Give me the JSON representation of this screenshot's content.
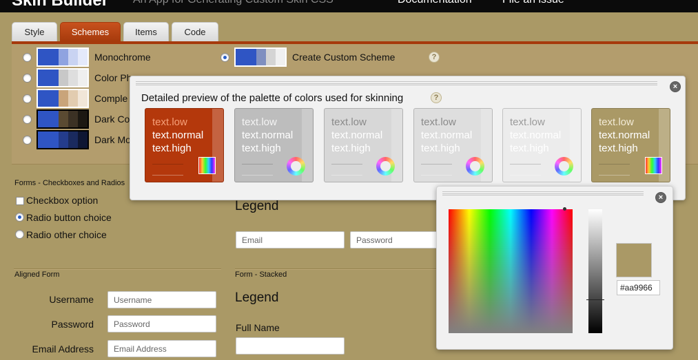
{
  "header": {
    "app_title": "Skin Builder",
    "app_subtitle": "An App for Generating Custom Skin CSS",
    "nav": [
      {
        "label": "Documentation"
      },
      {
        "label": "File an issue"
      }
    ]
  },
  "tabs": [
    {
      "label": "Style",
      "active": false
    },
    {
      "label": "Schemes",
      "active": true
    },
    {
      "label": "Items",
      "active": false
    },
    {
      "label": "Code",
      "active": false
    }
  ],
  "schemes": [
    {
      "label": "Monochrome",
      "selected": false,
      "swatches": [
        "#2f55c4",
        "#8fa3e0",
        "#c9d3f2",
        "#e4e9fa"
      ]
    },
    {
      "label": "Color Pho",
      "selected": false,
      "swatches": [
        "#2f55c4",
        "#c8c8c8",
        "#dedede",
        "#efefef"
      ]
    },
    {
      "label": "Comple",
      "selected": false,
      "swatches": [
        "#2f55c4",
        "#c9a47a",
        "#e2ccb0",
        "#f1e6d8"
      ]
    },
    {
      "label": "Dark Co",
      "selected": false,
      "swatches": [
        "#2f55c4",
        "#5a4a32",
        "#3b3124",
        "#1c1812"
      ]
    },
    {
      "label": "Dark Mo",
      "selected": false,
      "swatches": [
        "#2f55c4",
        "#243c8c",
        "#1a2a5e",
        "#0e1633"
      ]
    }
  ],
  "custom_scheme": {
    "label": "Create Custom Scheme",
    "selected": true,
    "swatches": [
      "#2f55c4",
      "#7f8fc0",
      "#d4d4d4",
      "#f0f0f0"
    ],
    "help": "?"
  },
  "palette_popup": {
    "heading": "Detailed preview of the palette of colors used for skinning",
    "help": "?",
    "close": "×",
    "cards": [
      {
        "bg": "#b4380c",
        "low": "text.low",
        "normal": "text.normal",
        "high": "text.high",
        "low_color": "#f6a07a",
        "color": "#ffffff",
        "icon": "gradient-square-icon"
      },
      {
        "bg": "#bdbdbd",
        "low": "text.low",
        "normal": "text.normal",
        "high": "text.high",
        "low_color": "#f4f4f4",
        "color": "#ffffff",
        "icon": "color-wheel-icon"
      },
      {
        "bg": "#d7d7d7",
        "low": "text.low",
        "normal": "text.normal",
        "high": "text.high",
        "low_color": "#8a8a8a",
        "color": "#ffffff",
        "icon": "color-wheel-icon"
      },
      {
        "bg": "#dedede",
        "low": "text.low",
        "normal": "text.normal",
        "high": "text.high",
        "low_color": "#8a8a8a",
        "color": "#ffffff",
        "icon": "color-wheel-icon"
      },
      {
        "bg": "#ececec",
        "low": "text.low",
        "normal": "text.normal",
        "high": "text.high",
        "low_color": "#9a9a9a",
        "color": "#ffffff",
        "icon": "color-wheel-icon"
      },
      {
        "bg": "#aa9966",
        "low": "text.low",
        "normal": "text.normal",
        "high": "text.high",
        "low_color": "#f2ead6",
        "color": "#ffffff",
        "icon": "gradient-square-icon"
      }
    ]
  },
  "forms": {
    "checkboxes_title": "Forms - Checkboxes and Radios",
    "checkbox_option": "Checkbox option",
    "radio_choice": "Radio button choice",
    "radio_other": "Radio other choice",
    "aligned_title": "Aligned Form",
    "username_label": "Username",
    "username_placeholder": "Username",
    "password_label": "Password",
    "password_placeholder": "Password",
    "email_label": "Email Address",
    "email_placeholder": "Email Address",
    "legend_top": "Legend",
    "email_inline_placeholder": "Email",
    "password_inline_placeholder": "Password",
    "stacked_title": "Form - Stacked",
    "legend_stacked": "Legend",
    "fullname_label": "Full Name"
  },
  "picker": {
    "close": "×",
    "selected_color": "#aa9966",
    "hex_value": "#aa9966"
  }
}
